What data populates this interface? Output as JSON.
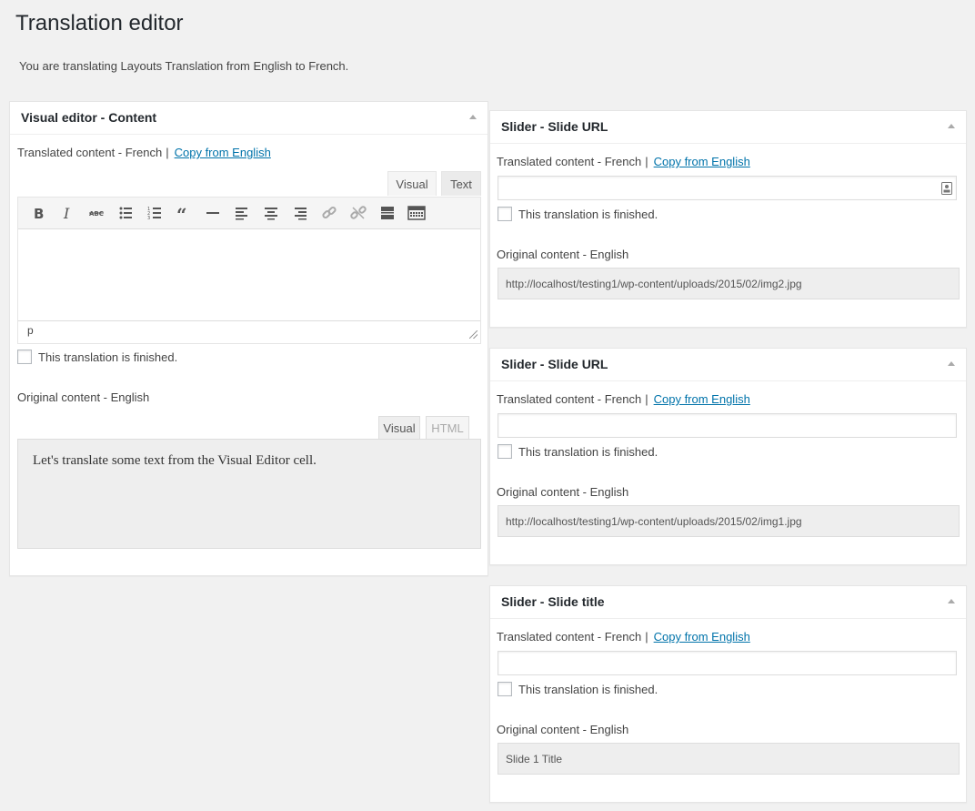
{
  "page": {
    "title": "Translation editor",
    "subtitle": "You are translating Layouts Translation from English to French."
  },
  "visual_box": {
    "title": "Visual editor - Content",
    "translated_label": "Translated content - French",
    "separator": "|",
    "copy_link": "Copy from English",
    "tabs": {
      "visual": "Visual",
      "text": "Text"
    },
    "toolbar": [
      "bold-icon",
      "italic-icon",
      "strikethrough-icon",
      "bullet-list-icon",
      "numbered-list-icon",
      "blockquote-icon",
      "horizontal-rule-icon",
      "align-left-icon",
      "align-center-icon",
      "align-right-icon",
      "link-icon",
      "unlink-icon",
      "read-more-icon",
      "toolbar-toggle-icon"
    ],
    "status_path": "p",
    "finished_label": "This translation is finished.",
    "original_label": "Original content - English",
    "original_tabs": {
      "visual": "Visual",
      "html": "HTML"
    },
    "original_text": "Let's translate some text from the Visual Editor cell."
  },
  "slide_boxes": [
    {
      "title": "Slider - Slide URL",
      "translated_label": "Translated content - French",
      "separator": "|",
      "copy_link": "Copy from English",
      "finished_label": "This translation is finished.",
      "original_label": "Original content - English",
      "original_value": "http://localhost/testing1/wp-content/uploads/2015/02/img2.jpg"
    },
    {
      "title": "Slider - Slide URL",
      "translated_label": "Translated content - French",
      "separator": "|",
      "copy_link": "Copy from English",
      "finished_label": "This translation is finished.",
      "original_label": "Original content - English",
      "original_value": "http://localhost/testing1/wp-content/uploads/2015/02/img1.jpg"
    },
    {
      "title": "Slider - Slide title",
      "translated_label": "Translated content - French",
      "separator": "|",
      "copy_link": "Copy from English",
      "finished_label": "This translation is finished.",
      "original_label": "Original content - English",
      "original_value": "Slide 1 Title"
    }
  ],
  "colors": {
    "link": "#0073aa",
    "background": "#f1f1f1",
    "panel": "#ffffff"
  }
}
